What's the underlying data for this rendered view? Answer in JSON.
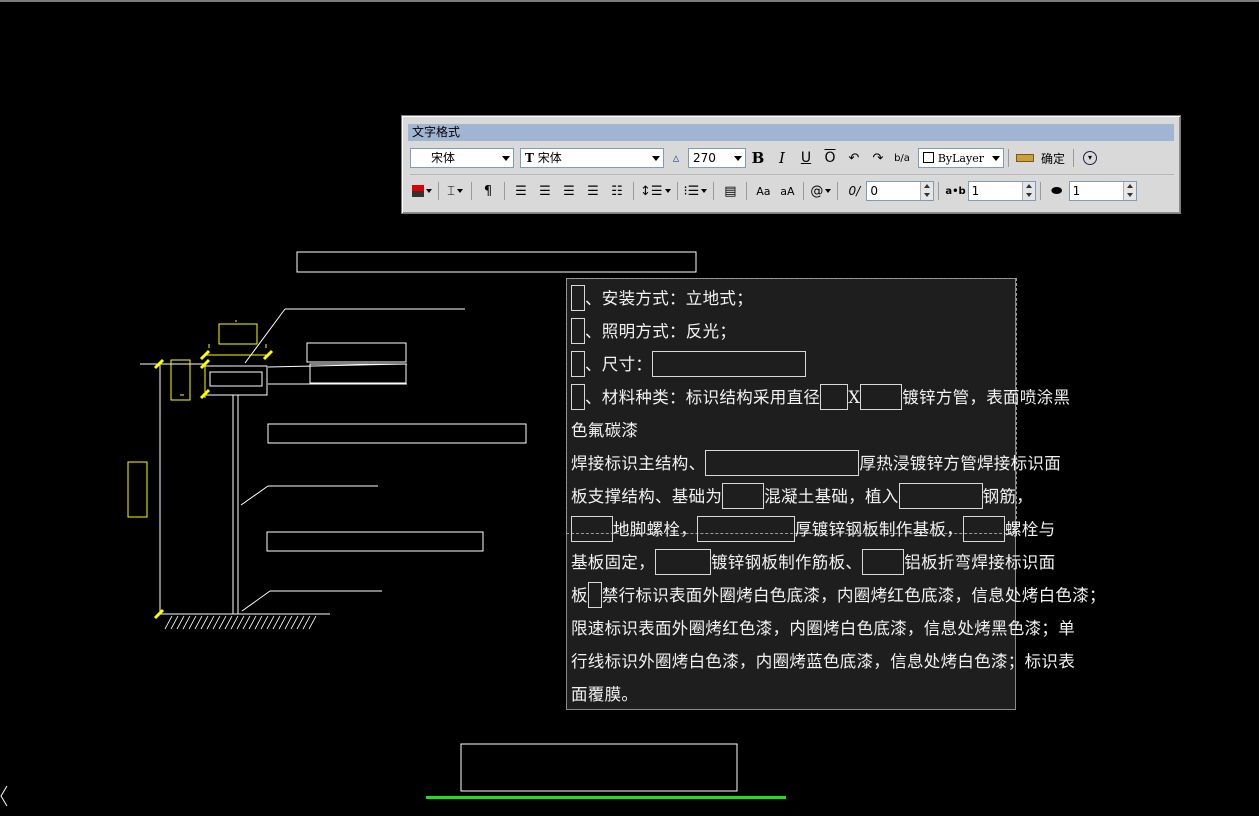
{
  "toolbar": {
    "title": "文字格式",
    "style_combo": "宋体",
    "font_combo": "宋体",
    "font_icon": "T",
    "height_value": "270",
    "bold": "B",
    "italic": "I",
    "underline": "U",
    "overline": "O",
    "stack_label": "b/a",
    "color_combo": "ByLayer",
    "ok_label": "确定",
    "case_upper": "Aa",
    "case_lower": "aA",
    "symbol": "@",
    "oblique_value": "0",
    "tracking_value": "1",
    "width_value": "1",
    "oblique_icon": "0/",
    "tracking_icon": "a•b",
    "icons": [
      "color-icon",
      "columns-icon",
      "justify-icon",
      "align-left-icon",
      "align-center-icon",
      "align-right-icon",
      "justify-all-icon",
      "distribute-icon",
      "line-spacing-icon",
      "numbering-icon",
      "insert-field-icon",
      "ruler-icon",
      "options-icon",
      "undo-icon",
      "redo-icon"
    ]
  },
  "editor": {
    "lines": [
      [
        "、安装方式：立地式；"
      ],
      [
        "、照明方式：反光；"
      ],
      [
        "、尺寸："
      ],
      [
        "、材料种类：标识结构采用直径",
        "X",
        "镀锌方管，表面喷涂黑"
      ],
      [
        "色氟碳漆"
      ],
      [
        "焊接标识主结构、",
        "厚热浸镀锌方管焊接标识面"
      ],
      [
        "板支撑结构、基础为",
        "混凝土基础，植入",
        "钢筋，"
      ],
      [
        "地脚螺栓，",
        "厚镀锌钢板制作基板，",
        "螺栓与"
      ],
      [
        "基板固定，",
        "镀锌钢板制作筋板、",
        "铝板折弯焊接标识面"
      ],
      [
        "板",
        "禁行标识表面外圈烤白色底漆，内圈烤红色底漆，信息处烤白色漆；"
      ],
      [
        "限速标识表面外圈烤红色漆，内圈烤白色底漆，信息处烤黑色漆；单"
      ],
      [
        "行线标识外圈烤白色漆，内圈烤蓝色底漆，信息处烤白色漆；标识表"
      ],
      [
        "面覆膜。"
      ]
    ]
  },
  "colors": {
    "accent_green": "#1ee01e",
    "dim_yellow": "#ffff00",
    "title_blue": "#9fb5d2"
  }
}
